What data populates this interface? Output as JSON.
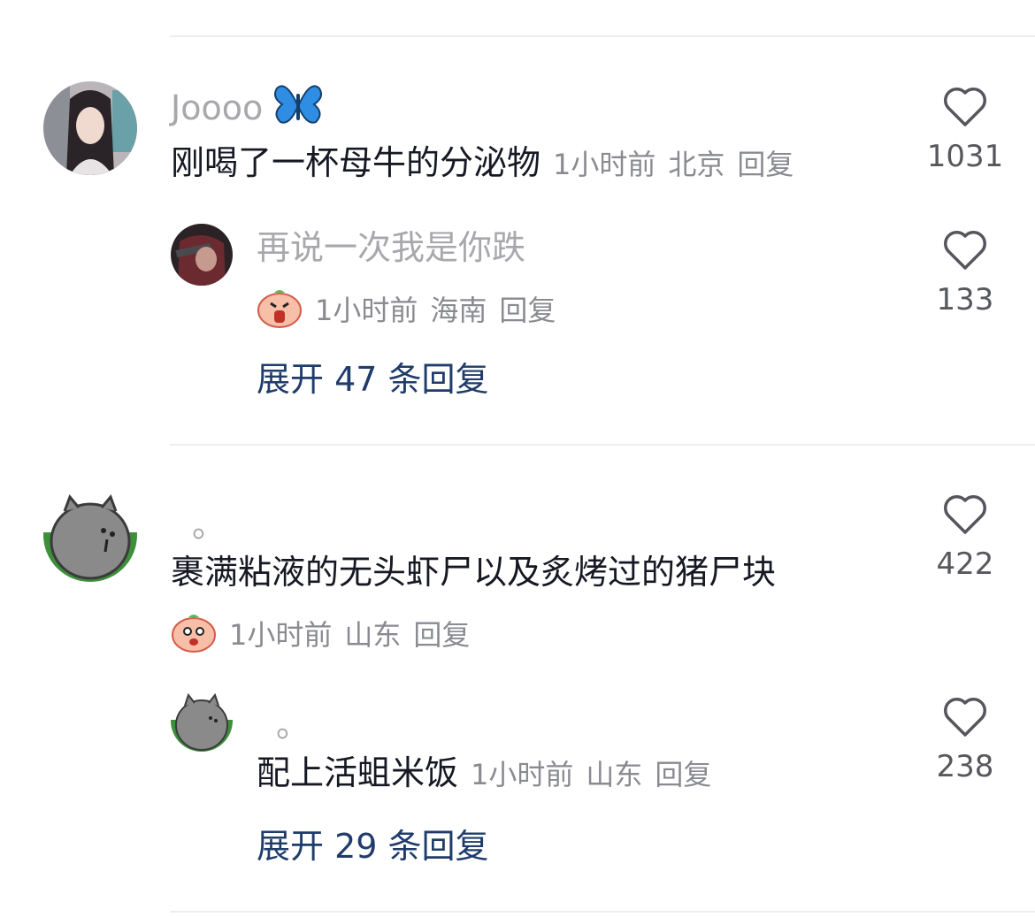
{
  "comments": [
    {
      "username": "Joooo",
      "name_emoji": "butterfly",
      "text": "刚喝了一杯母牛的分泌物",
      "time": "1小时前",
      "location": "北京",
      "reply_label": "回复",
      "likes": "1031",
      "reply": {
        "username": "再说一次我是你跌",
        "text_emoji": "shocked-peach-emoji",
        "time": "1小时前",
        "location": "海南",
        "reply_label": "回复",
        "likes": "133"
      },
      "expand_label": "展开 47 条回复"
    },
    {
      "username": "。",
      "text": "裹满粘液的无头虾尸以及炙烤过的猪尸块",
      "text_emoji": "nervous-peach-emoji",
      "time": "1小时前",
      "location": "山东",
      "reply_label": "回复",
      "likes": "422",
      "reply": {
        "username": "。",
        "text": "配上活蛆米饭",
        "time": "1小时前",
        "location": "山东",
        "reply_label": "回复",
        "likes": "238"
      },
      "expand_label": "展开 29 条回复"
    }
  ],
  "colors": {
    "text": "#161823",
    "muted": "#8a8b91",
    "expand_link": "#1f3c6a",
    "divider": "#ededed"
  }
}
